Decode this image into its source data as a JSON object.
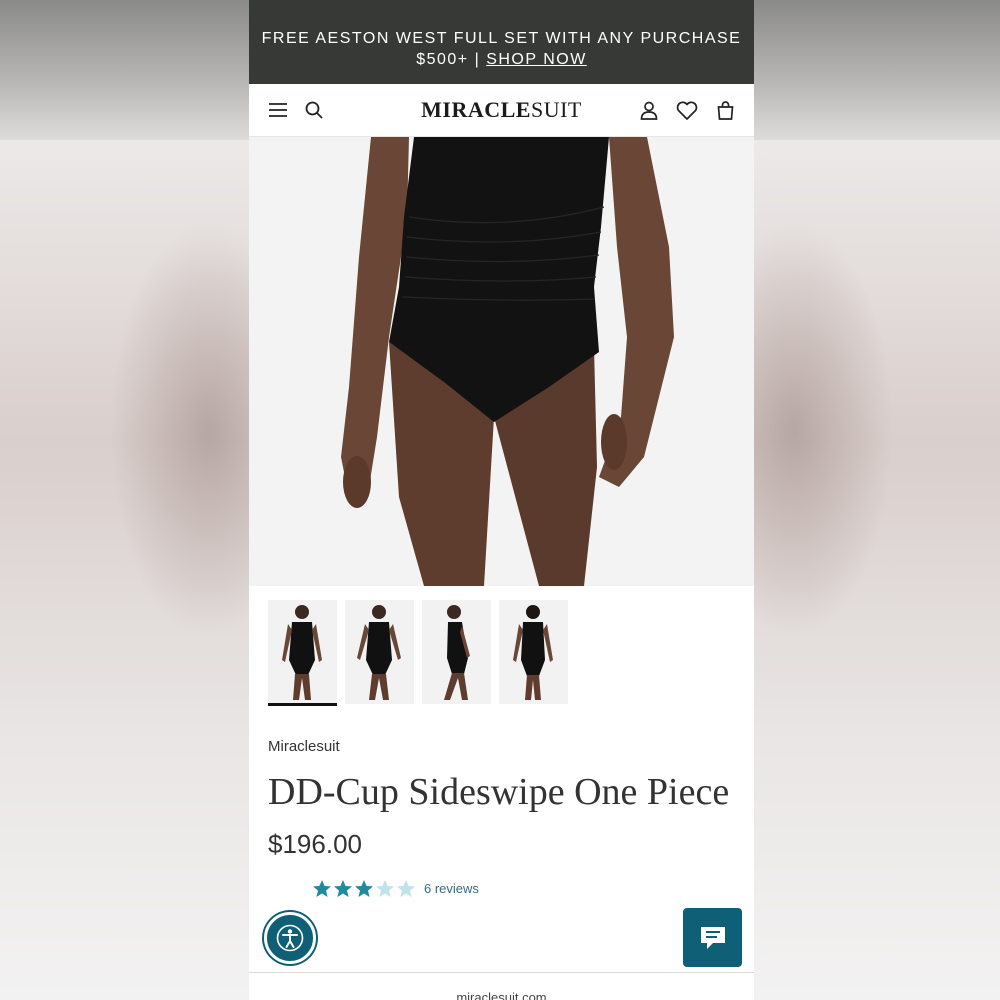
{
  "promo": {
    "line1": "FREE AESTON WEST FULL SET WITH ANY PURCHASE",
    "line2_prefix": "$500+ | ",
    "link": "SHOP NOW"
  },
  "header": {
    "logo_bold": "MIRACLE",
    "logo_light": "SUIT",
    "icons": [
      "menu-icon",
      "search-icon",
      "account-icon",
      "heart-icon",
      "bag-icon"
    ]
  },
  "product": {
    "brand": "Miraclesuit",
    "title": "DD-Cup Sideswipe One Piece",
    "price": "$196.00",
    "rating": 3,
    "rating_max": 5,
    "reviews": "6 reviews",
    "thumbnails": [
      "front view",
      "front view 2",
      "side view",
      "back view"
    ],
    "active_thumbnail": 0
  },
  "footer": {
    "url": "miraclesuit.com"
  },
  "colors": {
    "promo_bg": "#373937",
    "accent": "#0f5f76",
    "star": "#1f8aa0",
    "star_empty": "#bfe3ea"
  }
}
